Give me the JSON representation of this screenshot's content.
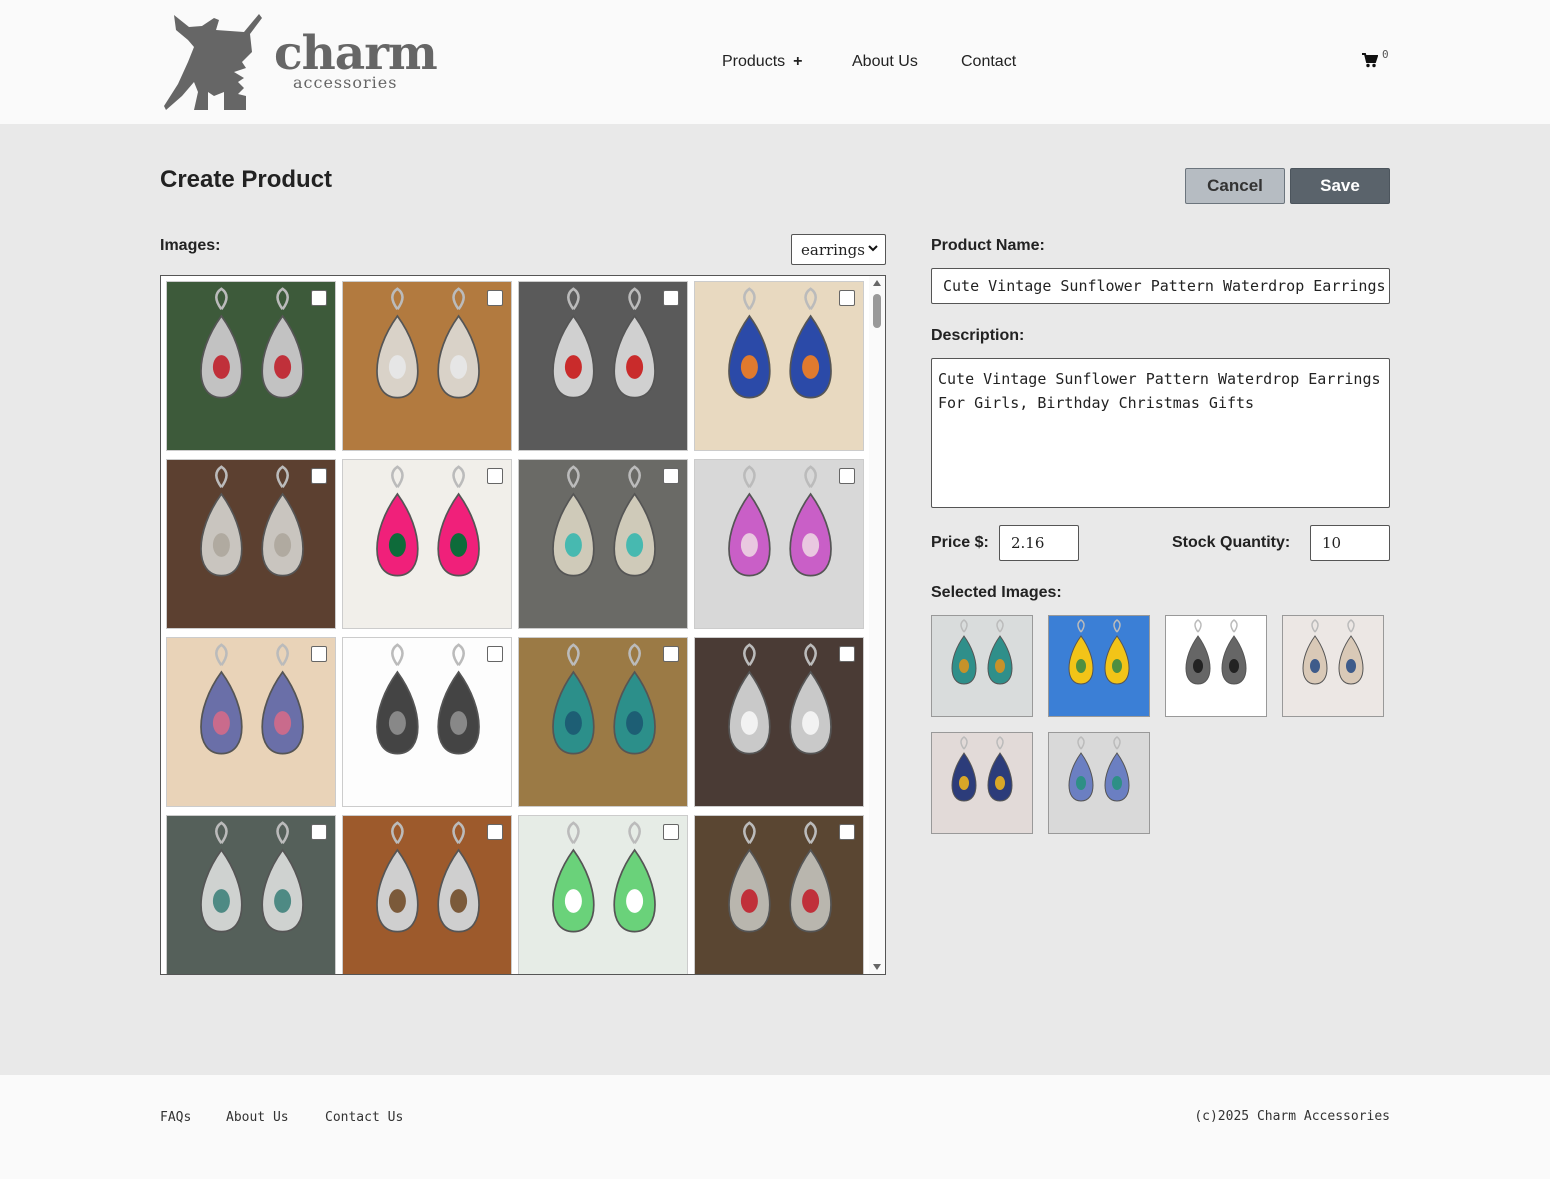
{
  "brand": {
    "name": "charm",
    "tagline": "accessories"
  },
  "nav": [
    {
      "label": "Products",
      "has_plus": true
    },
    {
      "label": "About Us"
    },
    {
      "label": "Contact"
    }
  ],
  "cart": {
    "count": "0"
  },
  "page": {
    "title": "Create Product",
    "cancel_label": "Cancel",
    "save_label": "Save",
    "images_label": "Images:",
    "category_value": "earrings"
  },
  "form": {
    "product_name_label": "Product Name:",
    "product_name_value": "Cute Vintage Sunflower Pattern Waterdrop Earrings For Girls, Birthday Christmas Gifts",
    "description_label": "Description:",
    "description_value": "Cute Vintage Sunflower Pattern Waterdrop Earrings For Girls, Birthday Christmas Gifts",
    "price_label": "Price $:",
    "price_value": "2.16",
    "stock_label": "Stock Quantity:",
    "stock_value": "10",
    "selected_images_label": "Selected Images:"
  },
  "image_grid": {
    "tiles": [
      {
        "bg": "#3d5a3a",
        "accent": "#c2c2c2",
        "gem": "#c0303a"
      },
      {
        "bg": "#b27a3f",
        "accent": "#d9d2c8",
        "gem": "#e6e6e6"
      },
      {
        "bg": "#5a5a5a",
        "accent": "#d0d0d0",
        "gem": "#c92b2b"
      },
      {
        "bg": "#e8d9c0",
        "accent": "#2b4aa8",
        "gem": "#e07a2e"
      },
      {
        "bg": "#5c4030",
        "accent": "#c9c5bf",
        "gem": "#b0aaa0"
      },
      {
        "bg": "#f1efea",
        "accent": "#f0207a",
        "gem": "#0e6b3a"
      },
      {
        "bg": "#6a6a66",
        "accent": "#cfcab9",
        "gem": "#47b9b0"
      },
      {
        "bg": "#d8d8d8",
        "accent": "#c95fc7",
        "gem": "#e9c8e0"
      },
      {
        "bg": "#e9d3b8",
        "accent": "#6a6fa8",
        "gem": "#c96b8c"
      },
      {
        "bg": "#fdfdfd",
        "accent": "#444444",
        "gem": "#888888"
      },
      {
        "bg": "#9b7a45",
        "accent": "#2c8f8a",
        "gem": "#1d5e74"
      },
      {
        "bg": "#4a3b35",
        "accent": "#c9c9c9",
        "gem": "#f2f2f2"
      },
      {
        "bg": "#55605a",
        "accent": "#cfd2d0",
        "gem": "#4e8a84"
      },
      {
        "bg": "#9d5a2c",
        "accent": "#cfcfcf",
        "gem": "#7b5a3a"
      },
      {
        "bg": "#e6ece6",
        "accent": "#6ad27a",
        "gem": "#ffffff"
      },
      {
        "bg": "#5a4632",
        "accent": "#b9b6ae",
        "gem": "#c0303a"
      }
    ]
  },
  "selected_images": [
    {
      "bg": "#d9dcdc",
      "accent": "#2f8f8a",
      "gem": "#c5922a"
    },
    {
      "bg": "#3b7fd6",
      "accent": "#f2c418",
      "gem": "#4f8f40"
    },
    {
      "bg": "#ffffff",
      "accent": "#666666",
      "gem": "#222222"
    },
    {
      "bg": "#ece7e4",
      "accent": "#d9c9b7",
      "gem": "#3e5b8a"
    },
    {
      "bg": "#e2dad8",
      "accent": "#2c3c7a",
      "gem": "#d9a728"
    },
    {
      "bg": "#d9d9d9",
      "accent": "#6b7fc2",
      "gem": "#2e8f86"
    }
  ],
  "footer": {
    "links": [
      "FAQs",
      "About Us",
      "Contact Us"
    ],
    "copyright": "(c)2025 Charm Accessories"
  },
  "icons": {
    "logo": "kangaroo-logo-icon",
    "cart": "shopping-cart-icon",
    "select": "chevron-down-icon"
  }
}
